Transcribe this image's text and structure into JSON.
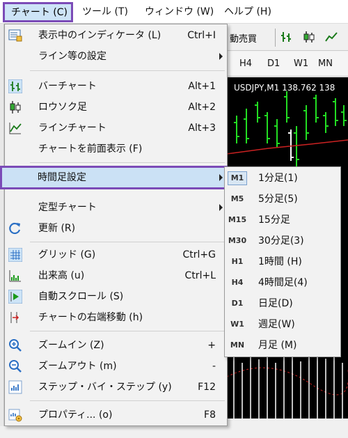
{
  "menubar": {
    "items": [
      "チャート (C)",
      "ツール (T)",
      "ウィンドウ (W)",
      "ヘルプ (H)"
    ]
  },
  "toolbar": {
    "trade_label": "動売買"
  },
  "timeframe_bar": {
    "items": [
      "H4",
      "D1",
      "W1",
      "MN"
    ]
  },
  "chart": {
    "title": "USDJPY,M1  138.762 138"
  },
  "chart_menu": {
    "items": [
      {
        "label": "表示中のインディケータ (L)",
        "shortcut": "Ctrl+I",
        "icon": "indicators-list-icon"
      },
      {
        "label": "ライン等の設定",
        "shortcut": "",
        "icon": ""
      },
      {
        "label": "バーチャート",
        "shortcut": "Alt+1",
        "icon": "bar-chart-icon"
      },
      {
        "label": "ロウソク足",
        "shortcut": "Alt+2",
        "icon": "candlestick-icon"
      },
      {
        "label": "ラインチャート",
        "shortcut": "Alt+3",
        "icon": "line-chart-icon"
      },
      {
        "label": "チャートを前面表示 (F)",
        "shortcut": "",
        "icon": ""
      },
      {
        "label": "時間足設定",
        "shortcut": "",
        "icon": ""
      },
      {
        "label": "定型チャート",
        "shortcut": "",
        "icon": ""
      },
      {
        "label": "更新 (R)",
        "shortcut": "",
        "icon": "refresh-icon"
      },
      {
        "label": "グリッド (G)",
        "shortcut": "Ctrl+G",
        "icon": "grid-icon"
      },
      {
        "label": "出来高 (u)",
        "shortcut": "Ctrl+L",
        "icon": "volume-icon"
      },
      {
        "label": "自動スクロール (S)",
        "shortcut": "",
        "icon": "auto-scroll-icon"
      },
      {
        "label": "チャートの右端移動 (h)",
        "shortcut": "",
        "icon": "chart-shift-icon"
      },
      {
        "label": "ズームイン (Z)",
        "shortcut": "+",
        "icon": "zoom-in-icon"
      },
      {
        "label": "ズームアウト (m)",
        "shortcut": "-",
        "icon": "zoom-out-icon"
      },
      {
        "label": "ステップ・バイ・ステップ (y)",
        "shortcut": "F12",
        "icon": "step-by-step-icon"
      },
      {
        "label": "プロパティ... (o)",
        "shortcut": "F8",
        "icon": "properties-icon"
      }
    ]
  },
  "timeframe_submenu": {
    "items": [
      {
        "badge": "M1",
        "label": "1分足(1)"
      },
      {
        "badge": "M5",
        "label": "5分足(5)"
      },
      {
        "badge": "M15",
        "label": "15分足"
      },
      {
        "badge": "M30",
        "label": "30分足(3)"
      },
      {
        "badge": "H1",
        "label": "1時間 (H)"
      },
      {
        "badge": "H4",
        "label": "4時間足(4)"
      },
      {
        "badge": "D1",
        "label": "日足(D)"
      },
      {
        "badge": "W1",
        "label": "週足(W)"
      },
      {
        "badge": "MN",
        "label": "月足 (M)"
      }
    ]
  },
  "colors": {
    "highlight_border": "#7b4bb7",
    "highlight_fill": "#cbe1f5",
    "candle_green": "#22dd22",
    "ma_red": "#cc2222"
  }
}
